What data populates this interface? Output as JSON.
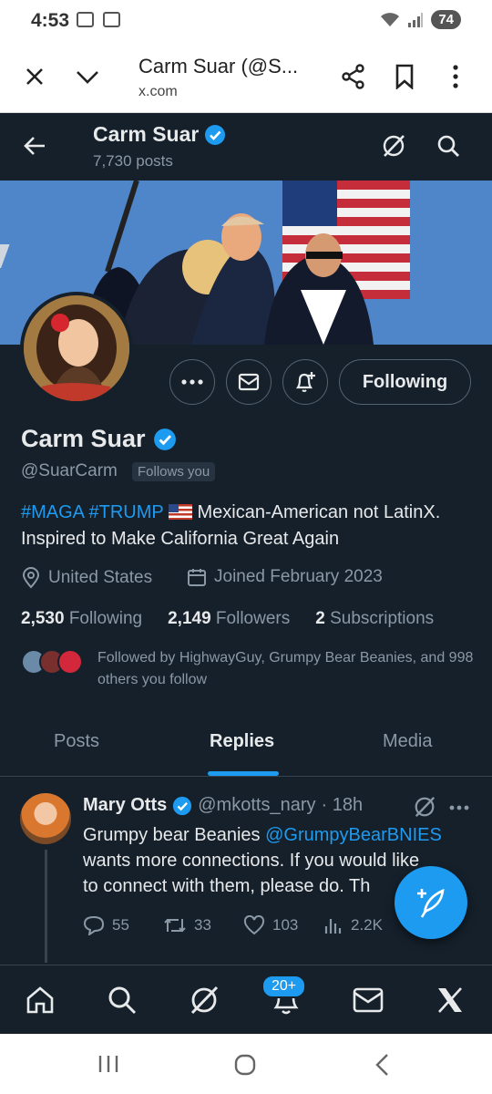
{
  "status_bar": {
    "time": "4:53",
    "battery": "74"
  },
  "browser": {
    "title": "Carm Suar (@S...",
    "url": "x.com"
  },
  "header": {
    "name": "Carm Suar",
    "posts_count": "7,730 posts"
  },
  "profile": {
    "name": "Carm Suar",
    "handle": "@SuarCarm",
    "follows_you": "Follows you",
    "following_button": "Following",
    "bio": {
      "tag1": "#MAGA",
      "tag2": "#TRUMP",
      "text": "Mexican-American not LatinX. Inspired to Make California Great Again"
    },
    "location": "United States",
    "joined": "Joined February 2023",
    "stats": {
      "following_count": "2,530",
      "following_label": "Following",
      "followers_count": "2,149",
      "followers_label": "Followers",
      "subscriptions_count": "2",
      "subscriptions_label": "Subscriptions"
    },
    "followed_by": "Followed by HighwayGuy, Grumpy Bear Beanies, and 998 others you follow"
  },
  "tabs": [
    "Posts",
    "Replies",
    "Media"
  ],
  "post": {
    "author": "Mary Otts",
    "handle": "@mkotts_nary",
    "time": "· 18h",
    "line1_pre": "Grumpy bear Beanies",
    "mention": "@GrumpyBearBNIES",
    "line2": "wants more connections. If you would like",
    "line3": "to connect with them, please do. Th",
    "replies": "55",
    "reposts": "33",
    "likes": "103",
    "views": "2.2K"
  },
  "bottom_nav": {
    "notifications_badge": "20+"
  },
  "colors": {
    "background": "#15202b",
    "accent": "#1d9bf0",
    "muted": "#8b98a5"
  }
}
